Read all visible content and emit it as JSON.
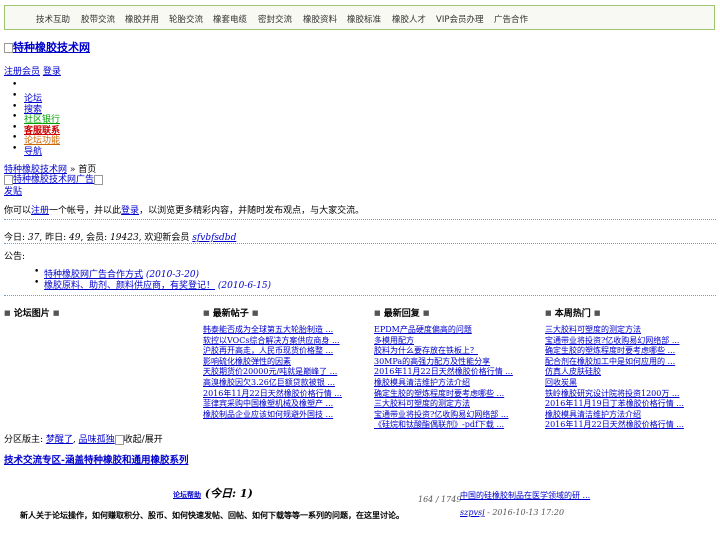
{
  "topnav": [
    "技术互助",
    "胶带交流",
    "橡胶并用",
    "轮胎交流",
    "橡套电缆",
    "密封交流",
    "橡胶资料",
    "橡胶标准",
    "橡胶人才",
    "VIP会员办理",
    "广告合作"
  ],
  "logo_alt": "特种橡胶技术网",
  "auth": {
    "register": "注册会员",
    "login": "登录"
  },
  "menu": [
    {
      "label": "论坛",
      "color": "#0000cc"
    },
    {
      "label": "搜索",
      "color": "#0000cc"
    },
    {
      "label": "社区银行",
      "color": "#00a000"
    },
    {
      "label": "客服联系",
      "color": "#cc0000"
    },
    {
      "label": "论坛功能",
      "color": "#cc6600"
    },
    {
      "label": "导航",
      "color": "#0000cc"
    }
  ],
  "breadcrumb": {
    "site": "特种橡胶技术网",
    "sep": " » ",
    "current": "首页"
  },
  "ad_alt": "特种橡胶技术网广告",
  "post_button": "发贴",
  "welcome": {
    "pre": "你可以",
    "register": "注册",
    "mid": "一个帐号，并以此",
    "login": "登录",
    "post": "，以浏览更多精彩内容，并随时发布观点，与大家交流。"
  },
  "stats": {
    "today_label": "今日: ",
    "today": "37",
    "yesterday_label": ", 昨日: ",
    "yesterday": "49",
    "members_label": ", 会员: ",
    "members": "19423",
    "newest_label": ", 欢迎新会员 ",
    "newest": "sfvbfsdbd"
  },
  "announce_label": "公告:",
  "announcements": [
    {
      "title": "特种橡胶网广告合作方式",
      "date": " (2010-3-20)"
    },
    {
      "title": "橡胶原料、助剂、颜料供应商，有奖登记！",
      "date": " (2010-6-15)"
    }
  ],
  "sections": {
    "pics": "论坛图片",
    "new_posts": "最新帖子",
    "new_replies": "最新回复",
    "hot": "本周热门"
  },
  "new_posts": [
    "韩泰能否成为全球第五大轮胎制造 ...",
    "软控以VOCs综合解决方案供应商身 ...",
    "沪胶再开高走，人民币现货价格整 ...",
    "影响硫化橡胶弹性的因素",
    "天胶期货价20000元/吨就是巅峰了 ...",
    "高溴橡胶因欠3.26亿巨额贷款被银 ...",
    "2016年11月22日天然橡胶价格行情 ...",
    "菲律宾采购中国橡塑机械及橡塑产 ...",
    "橡胶制品企业应该如何规避外国技 ..."
  ],
  "new_replies": [
    "EPDM产品硬度偏高的问题",
    "多模用配方",
    "胶料为什么要存放在铁板上？",
    "30MPa的高强力配方及性能分享",
    "2016年11月22日天然橡胶价格行情 ...",
    "橡胶模具清洁维护方法介绍",
    "确定生胶的塑炼程度时要考虑哪些 ...",
    "三大胶料可塑度的测定方法",
    "宝通带业将投资?亿收购易幻网络部 ...",
    "《硅烷和钛酸酯偶联剂》-pdf下载 ..."
  ],
  "hot": [
    "三大胶料可塑度的测定方法",
    "宝通带业将投资?亿收购易幻网络部 ...",
    "确定生胶的塑炼程度时要考虑哪些 ...",
    "配合剂在橡胶加工中是如何应用的 ...",
    "仿真人皮肤硅胶",
    "回收炭黑",
    "铁岭橡胶研究设计院将投资1200万 ...",
    "2016年11月19日丁苯橡胶价格行情 ...",
    "橡胶模具清洁维护方法介绍",
    "2016年11月22日天然橡胶价格行情 ..."
  ],
  "moderators": {
    "label": "分区版主: ",
    "m1": "梦醒了",
    "sep": ", ",
    "m2": "品味孤独",
    "collapse": "收起/展开"
  },
  "zone_title": "技术交流专区-涵盖特种橡胶和通用橡胶系列",
  "forum": {
    "name": "论坛帮助",
    "today": " (今日: 1)",
    "desc": "新人关于论坛操作，如何赚取积分、股币、如何快速发帖、回帖、如何下载等等一系列的问题，在这里讨论。",
    "counts": "164 / 1749",
    "last_title": "中国的硅橡胶制品在医学领域的研 ...",
    "last_user": "szpvsj",
    "last_date": " - 2016-10-13 17:20"
  }
}
